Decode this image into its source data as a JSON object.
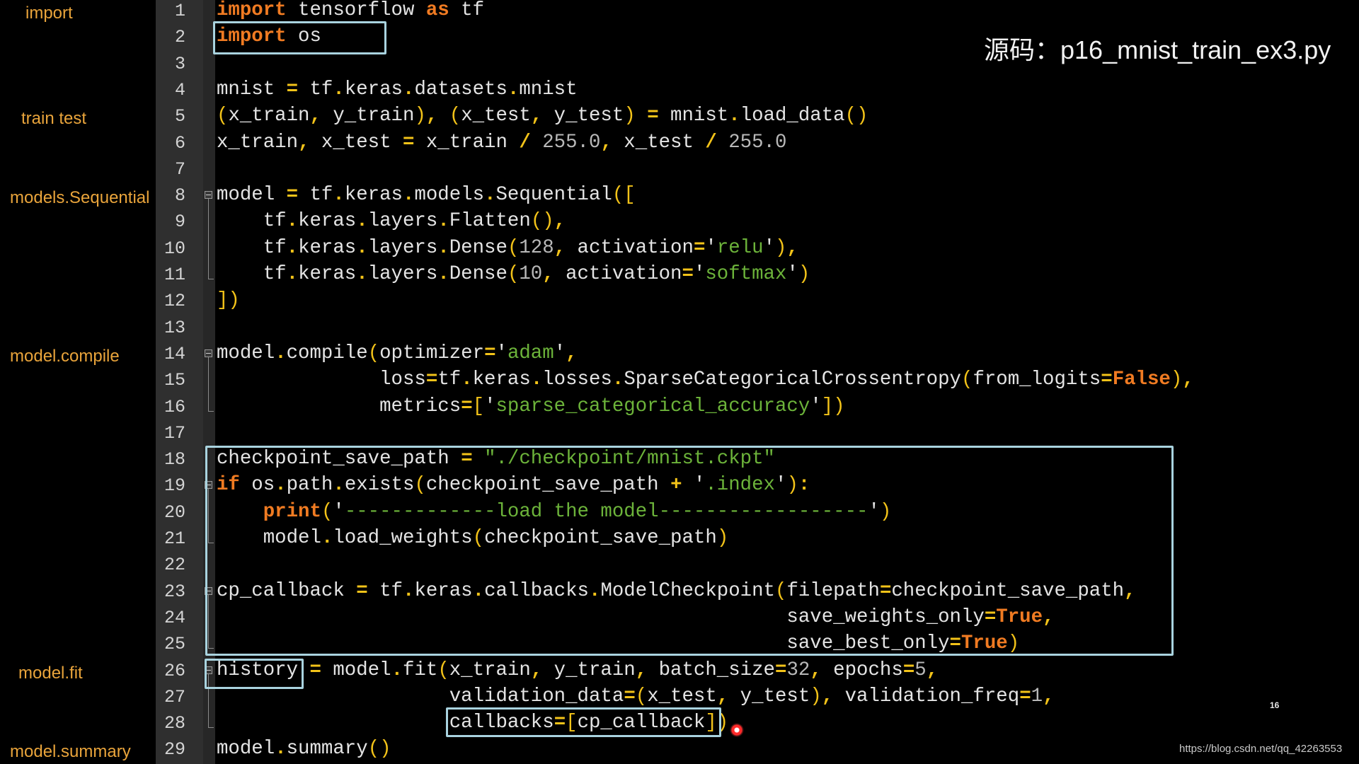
{
  "title": "源码：p16_mnist_train_ex3.py",
  "page_number": "16",
  "watermark": "https://blog.csdn.net/qq_42263553",
  "sidebar": {
    "labels": [
      {
        "text": "import",
        "line": 1
      },
      {
        "text": "train  test",
        "line": 5
      },
      {
        "text": "models.Sequential",
        "line": 8
      },
      {
        "text": "model.compile",
        "line": 14
      },
      {
        "text": "model.fit",
        "line": 26
      },
      {
        "text": "model.summary",
        "line": 29
      }
    ]
  },
  "colors": {
    "keyword": "#f07b22",
    "operator": "#f3c319",
    "string": "#6cb33a",
    "number": "#b8b8b8",
    "text": "#e4e4e4",
    "highlight_box": "#a9d3df",
    "sidebar_label": "#e9a43b",
    "cursor": "#ff2a2a"
  },
  "editor": {
    "lines": [
      {
        "n": "1",
        "tokens": [
          [
            "kw",
            "import"
          ],
          [
            "t",
            " tensorflow "
          ],
          [
            "kw",
            "as"
          ],
          [
            "t",
            " tf"
          ]
        ]
      },
      {
        "n": "2",
        "tokens": [
          [
            "kw",
            "import"
          ],
          [
            "t",
            " os"
          ]
        ]
      },
      {
        "n": "3",
        "tokens": []
      },
      {
        "n": "4",
        "tokens": [
          [
            "t",
            "mnist "
          ],
          [
            "op",
            "="
          ],
          [
            "t",
            " tf"
          ],
          [
            "op",
            "."
          ],
          [
            "t",
            "keras"
          ],
          [
            "op",
            "."
          ],
          [
            "t",
            "datasets"
          ],
          [
            "op",
            "."
          ],
          [
            "t",
            "mnist"
          ]
        ]
      },
      {
        "n": "5",
        "tokens": [
          [
            "p",
            "("
          ],
          [
            "t",
            "x_train"
          ],
          [
            "op",
            ","
          ],
          [
            "t",
            " y_train"
          ],
          [
            "p",
            ")"
          ],
          [
            "op",
            ","
          ],
          [
            "t",
            " "
          ],
          [
            "p",
            "("
          ],
          [
            "t",
            "x_test"
          ],
          [
            "op",
            ","
          ],
          [
            "t",
            " y_test"
          ],
          [
            "p",
            ")"
          ],
          [
            "t",
            " "
          ],
          [
            "op",
            "="
          ],
          [
            "t",
            " mnist"
          ],
          [
            "op",
            "."
          ],
          [
            "t",
            "load_data"
          ],
          [
            "p",
            "()"
          ]
        ]
      },
      {
        "n": "6",
        "tokens": [
          [
            "t",
            "x_train"
          ],
          [
            "op",
            ","
          ],
          [
            "t",
            " x_test "
          ],
          [
            "op",
            "="
          ],
          [
            "t",
            " x_train "
          ],
          [
            "op",
            "/"
          ],
          [
            "t",
            " "
          ],
          [
            "num",
            "255.0"
          ],
          [
            "op",
            ","
          ],
          [
            "t",
            " x_test "
          ],
          [
            "op",
            "/"
          ],
          [
            "t",
            " "
          ],
          [
            "num",
            "255.0"
          ]
        ]
      },
      {
        "n": "7",
        "tokens": []
      },
      {
        "n": "8",
        "tokens": [
          [
            "t",
            "model "
          ],
          [
            "op",
            "="
          ],
          [
            "t",
            " tf"
          ],
          [
            "op",
            "."
          ],
          [
            "t",
            "keras"
          ],
          [
            "op",
            "."
          ],
          [
            "t",
            "models"
          ],
          [
            "op",
            "."
          ],
          [
            "t",
            "Sequential"
          ],
          [
            "p",
            "(["
          ]
        ]
      },
      {
        "n": "9",
        "tokens": [
          [
            "t",
            "    tf"
          ],
          [
            "op",
            "."
          ],
          [
            "t",
            "keras"
          ],
          [
            "op",
            "."
          ],
          [
            "t",
            "layers"
          ],
          [
            "op",
            "."
          ],
          [
            "t",
            "Flatten"
          ],
          [
            "p",
            "()"
          ],
          [
            "op",
            ","
          ]
        ]
      },
      {
        "n": "10",
        "tokens": [
          [
            "t",
            "    tf"
          ],
          [
            "op",
            "."
          ],
          [
            "t",
            "keras"
          ],
          [
            "op",
            "."
          ],
          [
            "t",
            "layers"
          ],
          [
            "op",
            "."
          ],
          [
            "t",
            "Dense"
          ],
          [
            "p",
            "("
          ],
          [
            "num",
            "128"
          ],
          [
            "op",
            ","
          ],
          [
            "t",
            " activation"
          ],
          [
            "op",
            "="
          ],
          [
            "q",
            "'"
          ],
          [
            "str",
            "relu"
          ],
          [
            "q",
            "'"
          ],
          [
            "p",
            ")"
          ],
          [
            "op",
            ","
          ]
        ]
      },
      {
        "n": "11",
        "tokens": [
          [
            "t",
            "    tf"
          ],
          [
            "op",
            "."
          ],
          [
            "t",
            "keras"
          ],
          [
            "op",
            "."
          ],
          [
            "t",
            "layers"
          ],
          [
            "op",
            "."
          ],
          [
            "t",
            "Dense"
          ],
          [
            "p",
            "("
          ],
          [
            "num",
            "10"
          ],
          [
            "op",
            ","
          ],
          [
            "t",
            " activation"
          ],
          [
            "op",
            "="
          ],
          [
            "q",
            "'"
          ],
          [
            "str",
            "softmax"
          ],
          [
            "q",
            "'"
          ],
          [
            "p",
            ")"
          ]
        ]
      },
      {
        "n": "12",
        "tokens": [
          [
            "p",
            "])"
          ]
        ]
      },
      {
        "n": "13",
        "tokens": []
      },
      {
        "n": "14",
        "tokens": [
          [
            "t",
            "model"
          ],
          [
            "op",
            "."
          ],
          [
            "t",
            "compile"
          ],
          [
            "p",
            "("
          ],
          [
            "t",
            "optimizer"
          ],
          [
            "op",
            "="
          ],
          [
            "q",
            "'"
          ],
          [
            "str",
            "adam"
          ],
          [
            "q",
            "'"
          ],
          [
            "op",
            ","
          ]
        ]
      },
      {
        "n": "15",
        "tokens": [
          [
            "t",
            "              loss"
          ],
          [
            "op",
            "="
          ],
          [
            "t",
            "tf"
          ],
          [
            "op",
            "."
          ],
          [
            "t",
            "keras"
          ],
          [
            "op",
            "."
          ],
          [
            "t",
            "losses"
          ],
          [
            "op",
            "."
          ],
          [
            "t",
            "SparseCategoricalCrossentropy"
          ],
          [
            "p",
            "("
          ],
          [
            "t",
            "from_logits"
          ],
          [
            "op",
            "="
          ],
          [
            "kw",
            "False"
          ],
          [
            "p",
            ")"
          ],
          [
            "op",
            ","
          ]
        ]
      },
      {
        "n": "16",
        "tokens": [
          [
            "t",
            "              metrics"
          ],
          [
            "op",
            "="
          ],
          [
            "p",
            "["
          ],
          [
            "q",
            "'"
          ],
          [
            "str",
            "sparse_categorical_accuracy"
          ],
          [
            "q",
            "'"
          ],
          [
            "p",
            "])"
          ]
        ]
      },
      {
        "n": "17",
        "tokens": []
      },
      {
        "n": "18",
        "tokens": [
          [
            "t",
            "checkpoint_save_path "
          ],
          [
            "op",
            "="
          ],
          [
            "t",
            " "
          ],
          [
            "str",
            "\"./checkpoint/mnist.ckpt\""
          ]
        ]
      },
      {
        "n": "19",
        "tokens": [
          [
            "kw",
            "if"
          ],
          [
            "t",
            " os"
          ],
          [
            "op",
            "."
          ],
          [
            "t",
            "path"
          ],
          [
            "op",
            "."
          ],
          [
            "t",
            "exists"
          ],
          [
            "p",
            "("
          ],
          [
            "t",
            "checkpoint_save_path "
          ],
          [
            "op",
            "+"
          ],
          [
            "t",
            " "
          ],
          [
            "q",
            "'"
          ],
          [
            "str",
            ".index"
          ],
          [
            "q",
            "'"
          ],
          [
            "p",
            ")"
          ],
          [
            "op",
            ":"
          ]
        ]
      },
      {
        "n": "20",
        "tokens": [
          [
            "t",
            "    "
          ],
          [
            "kw",
            "print"
          ],
          [
            "p",
            "("
          ],
          [
            "q",
            "'"
          ],
          [
            "str",
            "-------------load the model------------------"
          ],
          [
            "q",
            "'"
          ],
          [
            "p",
            ")"
          ]
        ]
      },
      {
        "n": "21",
        "tokens": [
          [
            "t",
            "    model"
          ],
          [
            "op",
            "."
          ],
          [
            "t",
            "load_weights"
          ],
          [
            "p",
            "("
          ],
          [
            "t",
            "checkpoint_save_path"
          ],
          [
            "p",
            ")"
          ]
        ]
      },
      {
        "n": "22",
        "tokens": []
      },
      {
        "n": "23",
        "tokens": [
          [
            "t",
            "cp_callback "
          ],
          [
            "op",
            "="
          ],
          [
            "t",
            " tf"
          ],
          [
            "op",
            "."
          ],
          [
            "t",
            "keras"
          ],
          [
            "op",
            "."
          ],
          [
            "t",
            "callbacks"
          ],
          [
            "op",
            "."
          ],
          [
            "t",
            "ModelCheckpoint"
          ],
          [
            "p",
            "("
          ],
          [
            "t",
            "filepath"
          ],
          [
            "op",
            "="
          ],
          [
            "t",
            "checkpoint_save_path"
          ],
          [
            "op",
            ","
          ]
        ]
      },
      {
        "n": "24",
        "tokens": [
          [
            "t",
            "                                                 save_weights_only"
          ],
          [
            "op",
            "="
          ],
          [
            "kw",
            "True"
          ],
          [
            "op",
            ","
          ]
        ]
      },
      {
        "n": "25",
        "tokens": [
          [
            "t",
            "                                                 save_best_only"
          ],
          [
            "op",
            "="
          ],
          [
            "kw",
            "True"
          ],
          [
            "p",
            ")"
          ]
        ]
      },
      {
        "n": "26",
        "tokens": [
          [
            "t",
            "history "
          ],
          [
            "op",
            "="
          ],
          [
            "t",
            " model"
          ],
          [
            "op",
            "."
          ],
          [
            "t",
            "fit"
          ],
          [
            "p",
            "("
          ],
          [
            "t",
            "x_train"
          ],
          [
            "op",
            ","
          ],
          [
            "t",
            " y_train"
          ],
          [
            "op",
            ","
          ],
          [
            "t",
            " batch_size"
          ],
          [
            "op",
            "="
          ],
          [
            "num",
            "32"
          ],
          [
            "op",
            ","
          ],
          [
            "t",
            " epochs"
          ],
          [
            "op",
            "="
          ],
          [
            "num",
            "5"
          ],
          [
            "op",
            ","
          ]
        ]
      },
      {
        "n": "27",
        "tokens": [
          [
            "t",
            "                    validation_data"
          ],
          [
            "op",
            "="
          ],
          [
            "p",
            "("
          ],
          [
            "t",
            "x_test"
          ],
          [
            "op",
            ","
          ],
          [
            "t",
            " y_test"
          ],
          [
            "p",
            ")"
          ],
          [
            "op",
            ","
          ],
          [
            "t",
            " validation_freq"
          ],
          [
            "op",
            "="
          ],
          [
            "num",
            "1"
          ],
          [
            "op",
            ","
          ]
        ]
      },
      {
        "n": "28",
        "tokens": [
          [
            "t",
            "                    callbacks"
          ],
          [
            "op",
            "="
          ],
          [
            "p",
            "["
          ],
          [
            "t",
            "cp_callback"
          ],
          [
            "p",
            "])"
          ]
        ]
      },
      {
        "n": "29",
        "tokens": [
          [
            "t",
            "model"
          ],
          [
            "op",
            "."
          ],
          [
            "t",
            "summary"
          ],
          [
            "p",
            "()"
          ]
        ]
      }
    ],
    "fold_markers": [
      {
        "start": 8,
        "end": 11
      },
      {
        "start": 14,
        "end": 16
      },
      {
        "start": 19,
        "end": 21
      },
      {
        "start": 23,
        "end": 25
      },
      {
        "start": 26,
        "end": 28
      }
    ],
    "highlights": [
      {
        "name": "import-os-highlight",
        "desc": "import os"
      },
      {
        "name": "checkpoint-block-highlight",
        "desc": "lines 18-25"
      },
      {
        "name": "history-highlight",
        "desc": "history"
      },
      {
        "name": "callbacks-highlight",
        "desc": "callbacks=[cp_callback]"
      }
    ]
  }
}
